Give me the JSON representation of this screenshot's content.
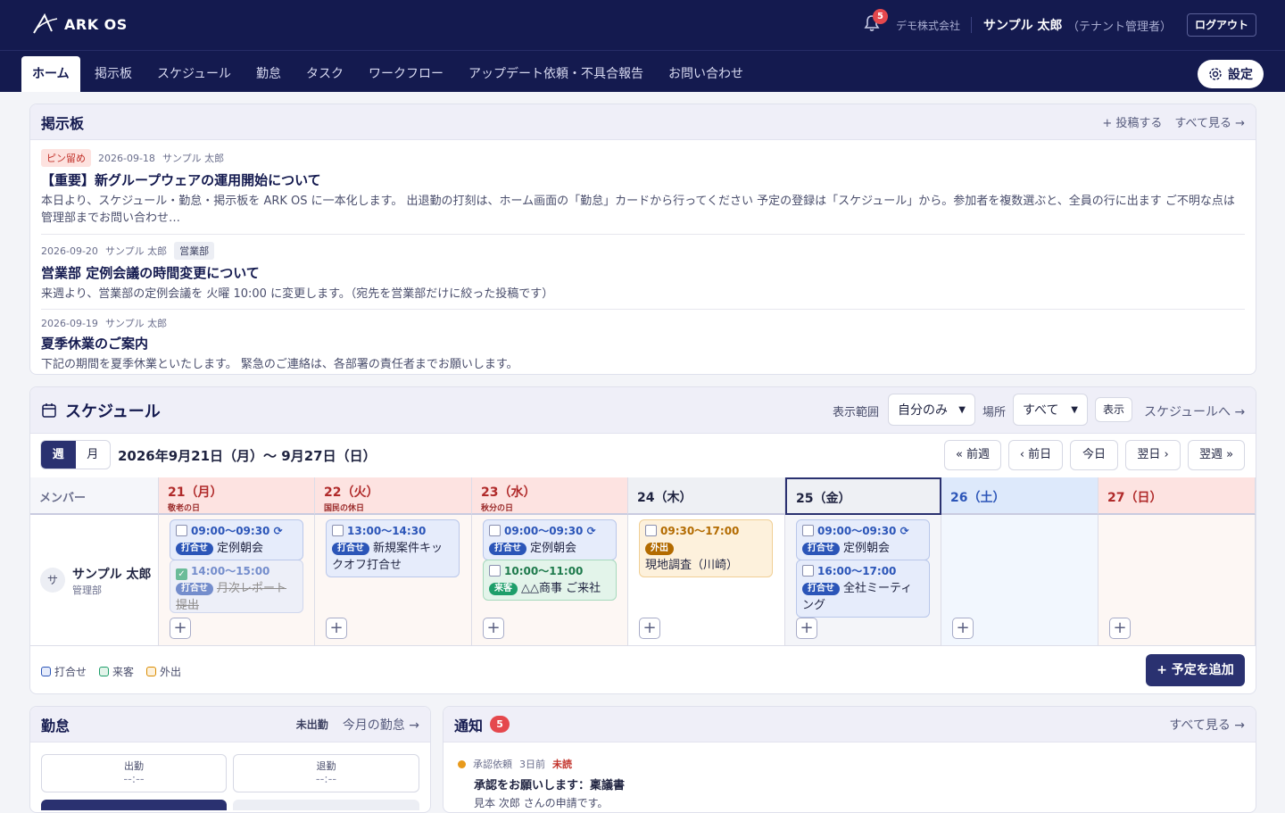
{
  "header": {
    "app_name": "ARK OS",
    "notification_count": "5",
    "company": "デモ株式会社",
    "user_name": "サンプル 太郎",
    "user_role": "（テナント管理者）",
    "logout_label": "ログアウト"
  },
  "nav": {
    "tabs": [
      {
        "label": "ホーム",
        "active": true
      },
      {
        "label": "掲示板"
      },
      {
        "label": "スケジュール"
      },
      {
        "label": "勤怠"
      },
      {
        "label": "タスク"
      },
      {
        "label": "ワークフロー"
      },
      {
        "label": "アップデート依頼・不具合報告"
      },
      {
        "label": "お問い合わせ"
      }
    ],
    "settings_label": "設定"
  },
  "board": {
    "title": "掲示板",
    "post_label": "+ 投稿する",
    "see_all": "すべて見る →",
    "posts": [
      {
        "pin": "ピン留め",
        "date": "2026-09-18",
        "author": "サンプル 太郎",
        "title": "【重要】新グループウェアの運用開始について",
        "body": "本日より、スケジュール・勤怠・掲示板を ARK OS に一本化します。 出退勤の打刻は、ホーム画面の「勤怠」カードから行ってください 予定の登録は「スケジュール」から。参加者を複数選ぶと、全員の行に出ます ご不明な点は管理部までお問い合わせ…"
      },
      {
        "date": "2026-09-20",
        "author": "サンプル 太郎",
        "dept": "営業部",
        "title": "営業部 定例会議の時間変更について",
        "body": "来週より、営業部の定例会議を 火曜 10:00 に変更します。（宛先を営業部だけに絞った投稿です）"
      },
      {
        "date": "2026-09-19",
        "author": "サンプル 太郎",
        "title": "夏季休業のご案内",
        "body": "下記の期間を夏季休業といたします。 緊急のご連絡は、各部署の責任者までお願いします。"
      }
    ]
  },
  "schedule": {
    "title": "スケジュール",
    "range_label": "表示範囲",
    "range_value": "自分のみ",
    "place_label": "場所",
    "place_value": "すべて",
    "show_btn": "表示",
    "link": "スケジュールへ →",
    "view_week": "週",
    "view_month": "月",
    "period": "2026年9月21日（月）〜 9月27日（日）",
    "nav": {
      "prev_week": "« 前週",
      "prev_day": "‹ 前日",
      "today": "今日",
      "next_day": "翌日 ›",
      "next_week": "翌週 »"
    },
    "member_header": "メンバー",
    "member": {
      "initial": "サ",
      "name": "サンプル 太郎",
      "dept": "管理部"
    },
    "days": [
      {
        "label": "21（月）",
        "sub": "敬老の日"
      },
      {
        "label": "22（火）",
        "sub": "国民の休日"
      },
      {
        "label": "23（水）",
        "sub": "秋分の日"
      },
      {
        "label": "24（木）",
        "sub": ""
      },
      {
        "label": "25（金）",
        "sub": ""
      },
      {
        "label": "26（土）",
        "sub": ""
      },
      {
        "label": "27（日）",
        "sub": ""
      }
    ],
    "events": {
      "d21a": {
        "time": "09:00〜09:30 ⟳",
        "tag": "打合せ",
        "title": "定例朝会"
      },
      "d21b": {
        "time": "14:00〜15:00",
        "tag": "打合せ",
        "title": "月次レポート提出"
      },
      "d22a": {
        "time": "13:00〜14:30",
        "tag": "打合せ",
        "title": "新規案件キックオフ打合せ"
      },
      "d23a": {
        "time": "09:00〜09:30 ⟳",
        "tag": "打合せ",
        "title": "定例朝会"
      },
      "d23b": {
        "time": "10:00〜11:00",
        "tag": "来客",
        "title": "△△商事 ご来社"
      },
      "d24a": {
        "time": "09:30〜17:00",
        "tag": "外出",
        "title": "現地調査（川崎）"
      },
      "d25a": {
        "time": "09:00〜09:30 ⟳",
        "tag": "打合せ",
        "title": "定例朝会"
      },
      "d25b": {
        "time": "16:00〜17:00",
        "tag": "打合せ",
        "title": "全社ミーティング"
      }
    },
    "legend": [
      "打合せ",
      "来客",
      "外出"
    ],
    "add_event": "+ 予定を追加"
  },
  "attendance": {
    "title": "勤怠",
    "status": "未出勤",
    "link": "今月の勤怠 →",
    "in_label": "出勤",
    "in_time": "--:--",
    "out_label": "退勤",
    "out_time": "--:--"
  },
  "notifications": {
    "title": "通知",
    "count": "5",
    "see_all": "すべて見る →",
    "items": [
      {
        "type": "承認依頼",
        "ago": "3日前",
        "status": "未読",
        "title": "承認をお願いします：稟議書",
        "body": "見本 次郎 さんの申請です。"
      }
    ]
  }
}
